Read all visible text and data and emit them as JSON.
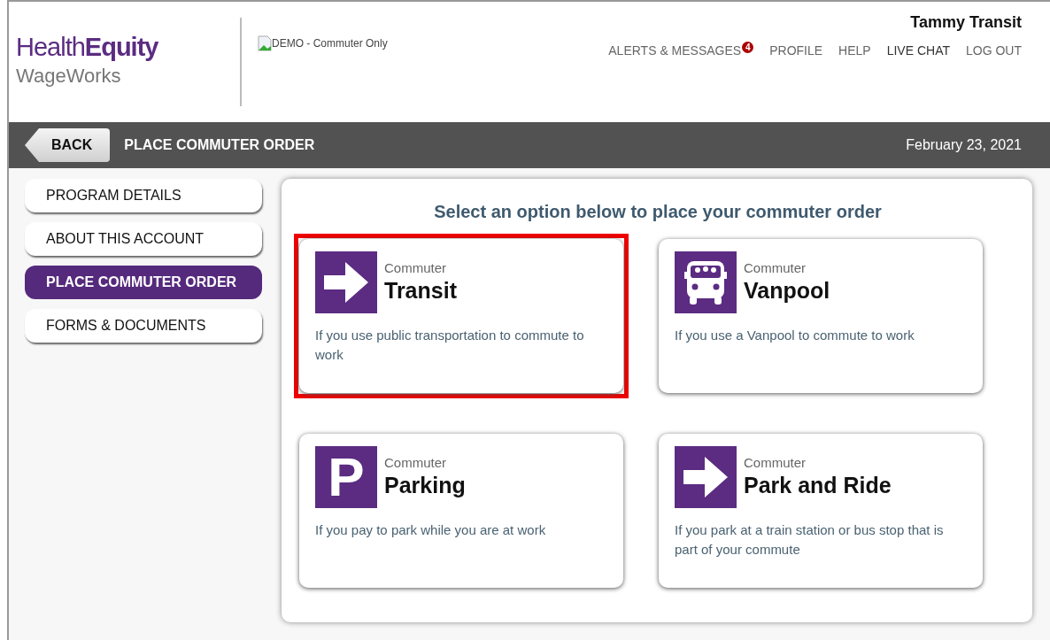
{
  "header": {
    "logo": {
      "primary_light": "Health",
      "primary_bold": "Equity",
      "secondary": "WageWorks"
    },
    "program_image_alt": "DEMO - Commuter Only",
    "user_name": "Tammy Transit",
    "links": [
      {
        "label": "ALERTS & MESSAGES",
        "badge": "4"
      },
      {
        "label": "PROFILE"
      },
      {
        "label": "HELP"
      },
      {
        "label": "LIVE CHAT"
      },
      {
        "label": "LOG OUT"
      }
    ]
  },
  "title_bar": {
    "back": "BACK",
    "title": "PLACE COMMUTER ORDER",
    "date": "February 23, 2021"
  },
  "sidebar": {
    "items": [
      {
        "label": "PROGRAM DETAILS",
        "selected": false
      },
      {
        "label": "ABOUT THIS ACCOUNT",
        "selected": false
      },
      {
        "label": "PLACE COMMUTER ORDER",
        "selected": true
      },
      {
        "label": "FORMS & DOCUMENTS",
        "selected": false
      }
    ]
  },
  "main": {
    "heading": "Select an option below to place your commuter order",
    "options": [
      {
        "kind": "arrow",
        "category": "Commuter",
        "name": "Transit",
        "description": "If you use public transportation to commute to work",
        "highlighted": true
      },
      {
        "kind": "van",
        "category": "Commuter",
        "name": "Vanpool",
        "description": "If you use a Vanpool to commute to work",
        "highlighted": false
      },
      {
        "kind": "letter",
        "glyph": "P",
        "category": "Commuter",
        "name": "Parking",
        "description": "If you pay to park while you are at work",
        "highlighted": false
      },
      {
        "kind": "arrow",
        "category": "Commuter",
        "name": "Park and Ride",
        "description": "If you park at a train station or bus stop that is part of your commute",
        "highlighted": false
      }
    ]
  }
}
